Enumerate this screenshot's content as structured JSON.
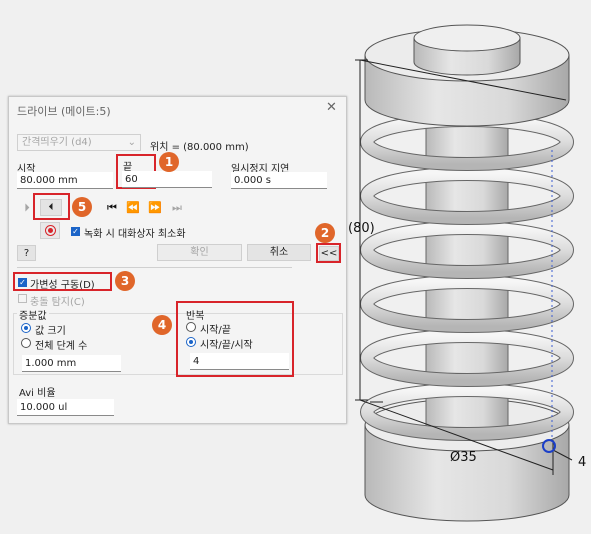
{
  "dialog": {
    "title": "드라이브 (메이트:5)",
    "close_glyph": "✕",
    "spacing_combo": "간격띄우기 (d4)",
    "position_text": "위치 = (80.000 mm)",
    "start_label": "시작",
    "start_value": "80.000 mm",
    "end_label": "끝",
    "end_value": "60",
    "pause_label": "일시정지 지연",
    "pause_value": "0.000 s",
    "play_forward_glyph": "⏵",
    "reverse_glyph": "⏴",
    "goto_start_glyph": "⏮",
    "step_back_glyph": "⏪",
    "step_fwd_glyph": "⏩",
    "goto_end_glyph": "⏭",
    "minimize_label": "녹화 시 대화상자 최소화",
    "help_glyph": "?",
    "ok_label": "확인",
    "cancel_label": "취소",
    "expand_label": "<<",
    "adaptive_label": "가변성 구동(D)",
    "collision_label": "충돌 탐지(C)",
    "increment_label": "증분값",
    "amount_label": "값 크기",
    "total_steps_label": "전체 단계 수",
    "increment_value": "1.000 mm",
    "repeat_label": "반복",
    "repeat_start_end": "시작/끝",
    "repeat_start_end_start": "시작/끝/시작",
    "repeat_value": "4",
    "avi_label": "Avi 비율",
    "avi_value": "10.000 ul"
  },
  "callouts": [
    "1",
    "2",
    "3",
    "4",
    "5"
  ],
  "viewport": {
    "dim_height": "(80)",
    "dim_diameter": "Ø35",
    "dim_right": "4"
  },
  "colors": {
    "accent": "#1b64c8",
    "callout": "#e0662a",
    "highlight": "#d8242a"
  }
}
